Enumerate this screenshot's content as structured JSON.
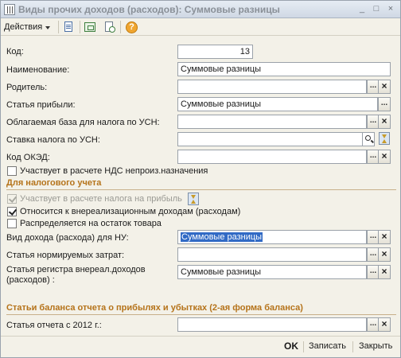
{
  "window": {
    "title": "Виды прочих доходов (расходов): Суммовые разницы",
    "buttons": [
      "_",
      "□",
      "×"
    ]
  },
  "toolbar": {
    "actions_label": "Действия",
    "icons": [
      "save-document-icon",
      "copy-icon",
      "create-based-on-icon",
      "help-icon"
    ],
    "help_glyph": "?"
  },
  "fields": {
    "kod": {
      "label": "Код:",
      "value": "13"
    },
    "name": {
      "label": "Наименование:",
      "value": "Суммовые разницы"
    },
    "parent": {
      "label": "Родитель:",
      "value": ""
    },
    "profit_item": {
      "label": "Статья прибыли:",
      "value": "Суммовые разницы"
    },
    "usn_base": {
      "label": "Облагаемая база для налога по УСН:",
      "value": ""
    },
    "usn_rate": {
      "label": "Ставка налога по УСН:",
      "value": ""
    },
    "okved": {
      "label": "Код ОКЭД:",
      "value": ""
    }
  },
  "checks": {
    "vat": {
      "label": "Участвует в расчете НДС непроиз.назначения",
      "checked": false
    },
    "profit_tax": {
      "label": "Участвует в расчете налога на прибыль",
      "checked": true,
      "disabled": true
    },
    "nonsale": {
      "label": "Относится к внереализационным доходам (расходам)",
      "checked": true
    },
    "remainder": {
      "label": "Распределяется на остаток товара",
      "checked": false
    }
  },
  "tax_section": {
    "title": "Для налогового учета",
    "nu_type": {
      "label": "Вид дохода (расхода) для НУ:",
      "value": "Суммовые разницы"
    },
    "norm_costs": {
      "label": "Статья нормируемых затрат:",
      "value": ""
    },
    "register_item": {
      "label": "Статья регистра внереал.доходов (расходов) :",
      "value": "Суммовые разницы"
    }
  },
  "balance_section": {
    "title": "Статьи баланса отчета о прибылях и убытках (2-ая форма баланса)",
    "report_item": {
      "label": "Статья отчета с 2012 г.:",
      "value": ""
    }
  },
  "footer": {
    "ok": "OK",
    "save": "Записать",
    "close": "Закрыть"
  }
}
